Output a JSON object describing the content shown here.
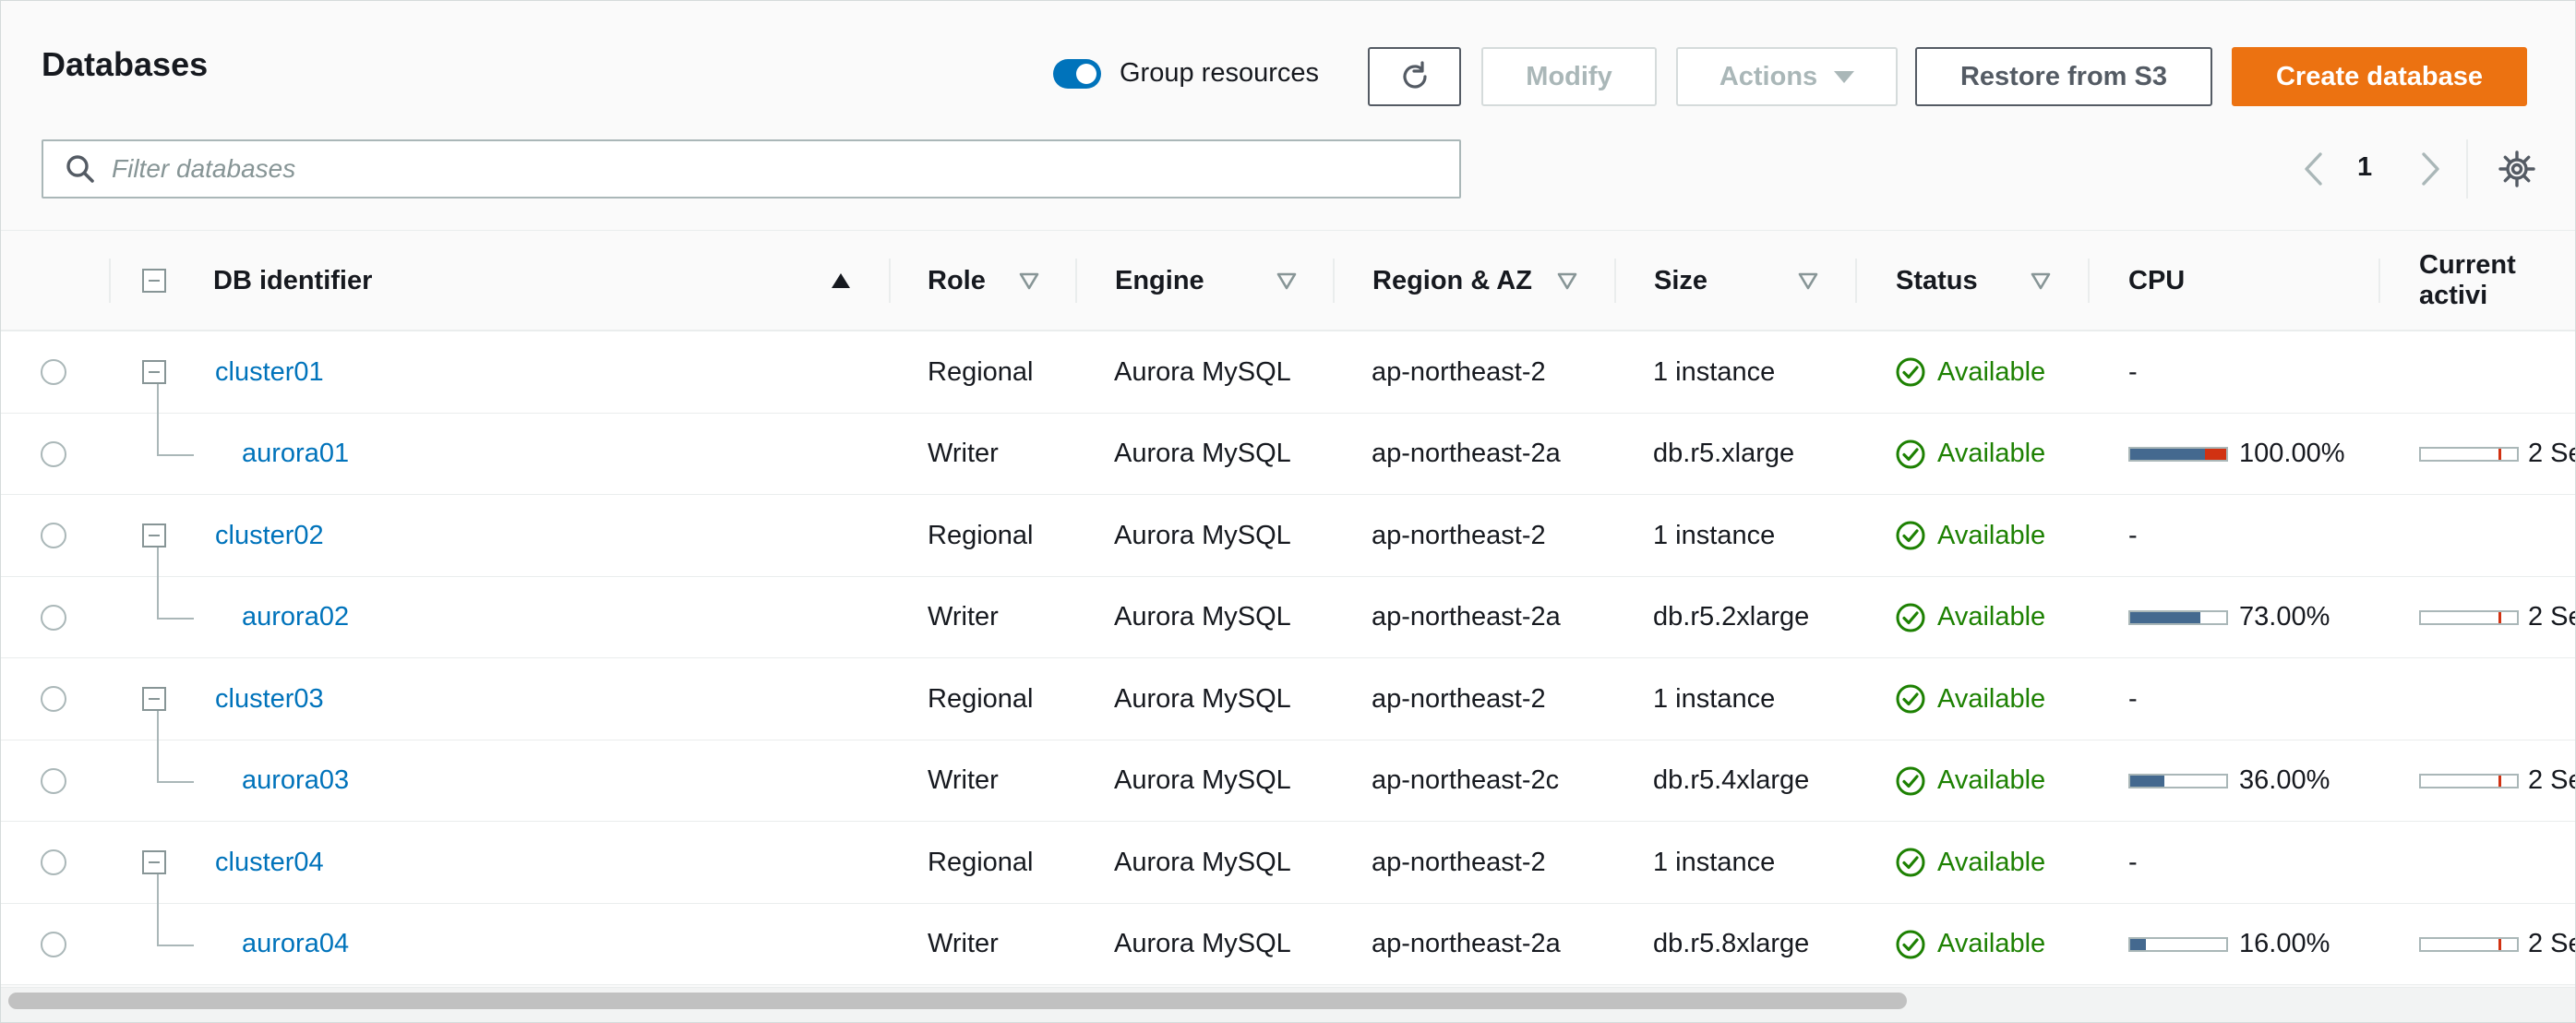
{
  "header": {
    "title": "Databases",
    "group_resources_label": "Group resources",
    "group_resources_enabled": true
  },
  "toolbar": {
    "refresh_icon": "refresh-icon",
    "modify_label": "Modify",
    "actions_label": "Actions",
    "restore_label": "Restore from S3",
    "create_label": "Create database"
  },
  "search": {
    "placeholder": "Filter databases",
    "value": ""
  },
  "pagination": {
    "current_page": "1"
  },
  "columns": {
    "db_identifier": "DB identifier",
    "role": "Role",
    "engine": "Engine",
    "region": "Region & AZ",
    "size": "Size",
    "status": "Status",
    "cpu": "CPU",
    "current_activity": "Current activi"
  },
  "colors": {
    "accent": "#0073bb",
    "primary_button": "#ec7211",
    "status_available": "#1d8102",
    "cpu_bar": "#44698f",
    "cpu_hot": "#d13212"
  },
  "rows": [
    {
      "id": "cluster01",
      "type": "cluster",
      "role": "Regional",
      "engine": "Aurora MySQL",
      "region": "ap-northeast-2",
      "size": "1 instance",
      "status": "Available",
      "cpu_text": "-"
    },
    {
      "id": "aurora01",
      "type": "instance",
      "role": "Writer",
      "engine": "Aurora MySQL",
      "region": "ap-northeast-2a",
      "size": "db.r5.xlarge",
      "status": "Available",
      "cpu_text": "100.00%",
      "cpu_value": 100,
      "activity_text": "2 Se"
    },
    {
      "id": "cluster02",
      "type": "cluster",
      "role": "Regional",
      "engine": "Aurora MySQL",
      "region": "ap-northeast-2",
      "size": "1 instance",
      "status": "Available",
      "cpu_text": "-"
    },
    {
      "id": "aurora02",
      "type": "instance",
      "role": "Writer",
      "engine": "Aurora MySQL",
      "region": "ap-northeast-2a",
      "size": "db.r5.2xlarge",
      "status": "Available",
      "cpu_text": "73.00%",
      "cpu_value": 73,
      "activity_text": "2 Se"
    },
    {
      "id": "cluster03",
      "type": "cluster",
      "role": "Regional",
      "engine": "Aurora MySQL",
      "region": "ap-northeast-2",
      "size": "1 instance",
      "status": "Available",
      "cpu_text": "-"
    },
    {
      "id": "aurora03",
      "type": "instance",
      "role": "Writer",
      "engine": "Aurora MySQL",
      "region": "ap-northeast-2c",
      "size": "db.r5.4xlarge",
      "status": "Available",
      "cpu_text": "36.00%",
      "cpu_value": 36,
      "activity_text": "2 Se"
    },
    {
      "id": "cluster04",
      "type": "cluster",
      "role": "Regional",
      "engine": "Aurora MySQL",
      "region": "ap-northeast-2",
      "size": "1 instance",
      "status": "Available",
      "cpu_text": "-"
    },
    {
      "id": "aurora04",
      "type": "instance",
      "role": "Writer",
      "engine": "Aurora MySQL",
      "region": "ap-northeast-2a",
      "size": "db.r5.8xlarge",
      "status": "Available",
      "cpu_text": "16.00%",
      "cpu_value": 16,
      "activity_text": "2 Se"
    }
  ]
}
